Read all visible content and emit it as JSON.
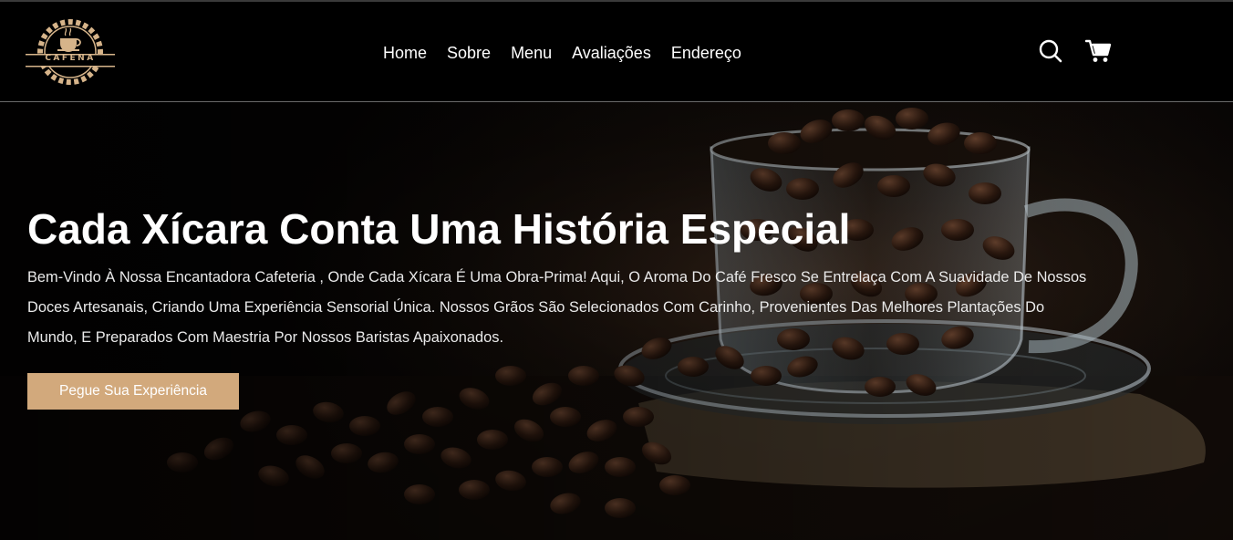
{
  "brand": {
    "logo_text": "CAFENA",
    "accent_color": "#d2a97c"
  },
  "nav": {
    "items": [
      {
        "label": "Home"
      },
      {
        "label": "Sobre"
      },
      {
        "label": "Menu"
      },
      {
        "label": "Avaliações"
      },
      {
        "label": "Endereço"
      }
    ]
  },
  "header_icons": {
    "search": "search-icon",
    "cart": "cart-icon"
  },
  "hero": {
    "title": "Cada Xícara Conta Uma História Especial",
    "text": "Bem-Vindo À Nossa Encantadora Cafeteria , Onde Cada Xícara É Uma Obra-Prima! Aqui, O Aroma Do Café Fresco Se Entrelaça Com A Suavidade De Nossos Doces Artesanais, Criando Uma Experiência Sensorial Única. Nossos Grãos São Selecionados Com Carinho, Provenientes Das Melhores Plantações Do Mundo, E Preparados Com Maestria Por Nossos Baristas Apaixonados.",
    "cta_label": "Pegue Sua Experiência",
    "image": "coffee-beans-glass-cup"
  }
}
